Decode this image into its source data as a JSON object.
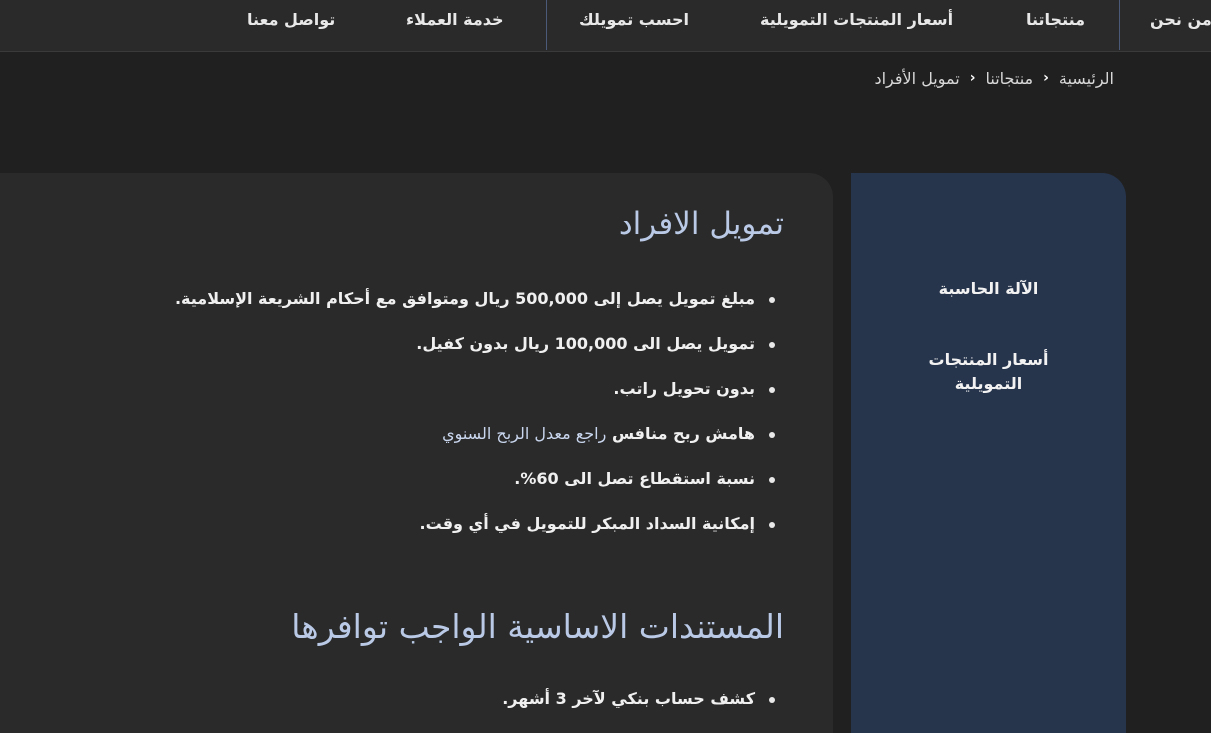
{
  "nav": {
    "about": "من نحن",
    "products": "منتجاتنا",
    "prices": "أسعار المنتجات التمويلية",
    "calculate": "احسب تمويلك",
    "customer_service": "خدمة العملاء",
    "contact": "تواصل معنا"
  },
  "breadcrumb": {
    "home": "الرئيسية",
    "products": "منتجاتنا",
    "current": "تمويل الأفراد"
  },
  "sidebar": {
    "calculator": "الآلة الحاسبة",
    "prices_line1": "أسعار المنتجات",
    "prices_line2": "التمويلية"
  },
  "main": {
    "title": "تمويل الافراد",
    "features": [
      "مبلغ تمويل يصل إلى 500,000 ريال ومتوافق مع أحكام الشريعة الإسلامية.",
      "تمويل يصل الى 100,000 ريال بدون كفيل.",
      "بدون تحويل راتب.",
      "هامش ربح منافس",
      "نسبة استقطاع تصل الى 60%.",
      "إمكانية السداد المبكر للتمويل في أي وقت."
    ],
    "rate_note": "راجع معدل الربح السنوي",
    "documents_title": "المستندات الاساسية الواجب توافرها",
    "documents": [
      "كشف حساب بنكي لآخر 3 أشهر."
    ]
  },
  "colors": {
    "background": "#202020",
    "card": "#2a2a2a",
    "sidebar": "#26344c",
    "heading": "#b9c9e6"
  }
}
